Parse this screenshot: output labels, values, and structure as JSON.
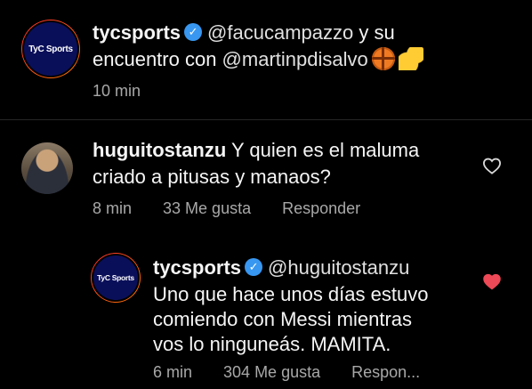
{
  "post": {
    "username": "tycsports",
    "mention": "@facucampazzo",
    "text_1": " y su",
    "text_2": "encuentro con ",
    "mention_2": "@martinpdisalvo",
    "time": "10 min",
    "avatar_text": "TyC Sports",
    "emojis": [
      "basketball-emoji",
      "flexed-biceps-emoji"
    ]
  },
  "comment": {
    "username": "huguitostanzu",
    "text_1": " Y quien es el maluma",
    "text_2": "criado a pitusas y manaos?",
    "time": "8 min",
    "likes": "33 Me gusta",
    "reply": "Responder",
    "liked": false
  },
  "reply": {
    "username": "tycsports",
    "mention": "@huguitostanzu",
    "text_1": "Uno que hace unos días estuvo",
    "text_2": "comiendo con Messi mientras",
    "text_3": "vos lo ninguneás. MAMITA.",
    "time": "6 min",
    "likes": "304 Me gusta",
    "reply": "Respon...",
    "avatar_text": "TyC Sports",
    "liked": true
  },
  "colors": {
    "background": "#000000",
    "verified": "#3897f0",
    "heart_liked": "#ed4956",
    "meta_text": "#a8a8a8",
    "divider": "#262626"
  },
  "icons": {
    "verified": "verified-badge-icon",
    "like": "heart-icon"
  }
}
